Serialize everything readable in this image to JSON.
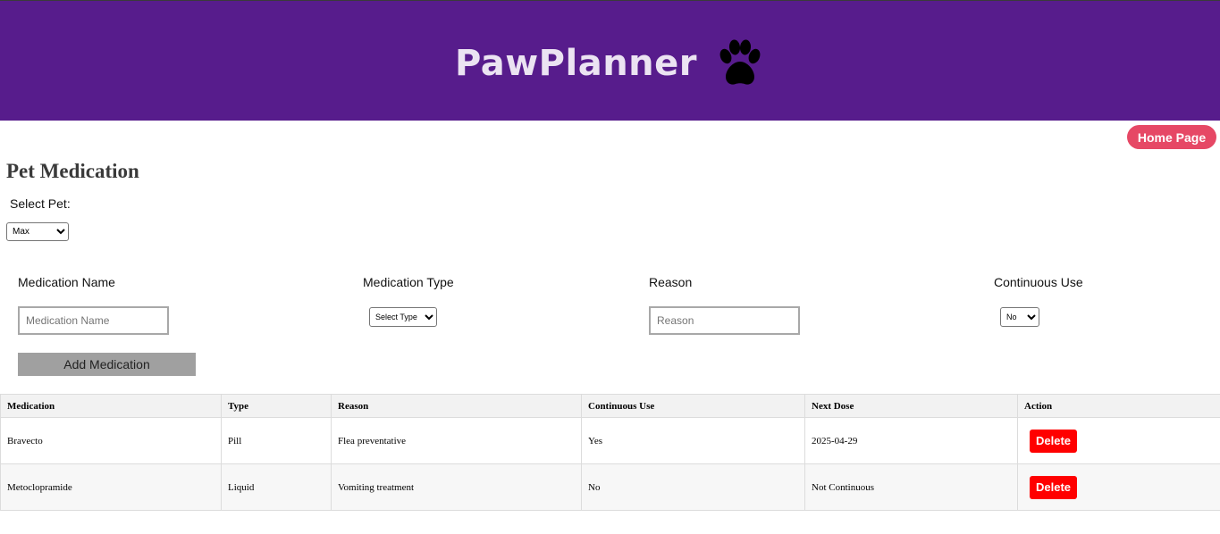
{
  "header": {
    "title": "PawPlanner",
    "logo_icon": "paw-icon",
    "background": "#571c8c"
  },
  "nav": {
    "home_label": "Home Page",
    "accent": "#e64865"
  },
  "page": {
    "title": "Pet Medication"
  },
  "pet_selector": {
    "label": "Select Pet:",
    "selected": "Max"
  },
  "form": {
    "name_label": "Medication Name",
    "name_placeholder": "Medication Name",
    "type_label": "Medication Type",
    "type_selected": "Select Type",
    "reason_label": "Reason",
    "reason_placeholder": "Reason",
    "continuous_label": "Continuous Use",
    "continuous_selected": "No",
    "add_label": "Add Medication"
  },
  "table": {
    "headers": [
      "Medication",
      "Type",
      "Reason",
      "Continuous Use",
      "Next Dose",
      "Action"
    ],
    "rows": [
      {
        "medication": "Bravecto",
        "type": "Pill",
        "reason": "Flea preventative",
        "continuous": "Yes",
        "next_dose": "2025-04-29",
        "action": "Delete"
      },
      {
        "medication": "Metoclopramide",
        "type": "Liquid",
        "reason": "Vomiting treatment",
        "continuous": "No",
        "next_dose": "Not Continuous",
        "action": "Delete"
      }
    ],
    "delete_color": "#ff0000"
  }
}
